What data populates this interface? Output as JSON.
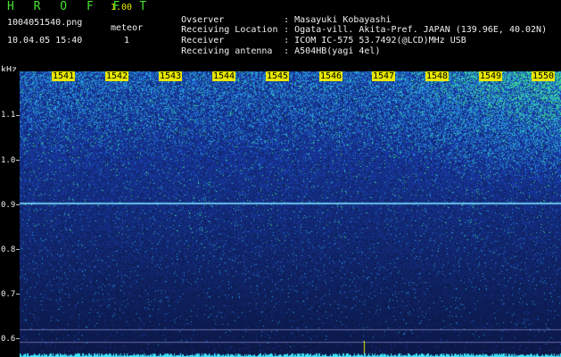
{
  "app": {
    "title": "H R O F F T",
    "version": "1.00"
  },
  "file": {
    "name": "1004051540.png",
    "datetime": "10.04.05 15:40"
  },
  "meteor": {
    "label": "meteor",
    "count": "1"
  },
  "info": [
    {
      "key": "Ovserver",
      "value": ": Masayuki Kobayashi"
    },
    {
      "key": "Receiving Location",
      "value": ": Ogata-vill. Akita-Pref. JAPAN (139.96E, 40.02N)"
    },
    {
      "key": "Receiver",
      "value": ": ICOM IC-575 53.7492(@LCD)MHz USB"
    },
    {
      "key": "Receiving antenna",
      "value": ": A504HB(yagi 4el)"
    }
  ],
  "axis": {
    "unit": "kHz",
    "y_labels": [
      "1.1",
      "1.0",
      "0.9",
      "0.8",
      "0.7",
      "0.6"
    ],
    "time_markers": [
      "1541",
      "1542",
      "1543",
      "1544",
      "1545",
      "1546",
      "1547",
      "1548",
      "1549",
      "1550"
    ]
  },
  "colors": {
    "title": "#46e22e",
    "marker_bg": "#e8e800",
    "trace": "#40e8ff"
  }
}
